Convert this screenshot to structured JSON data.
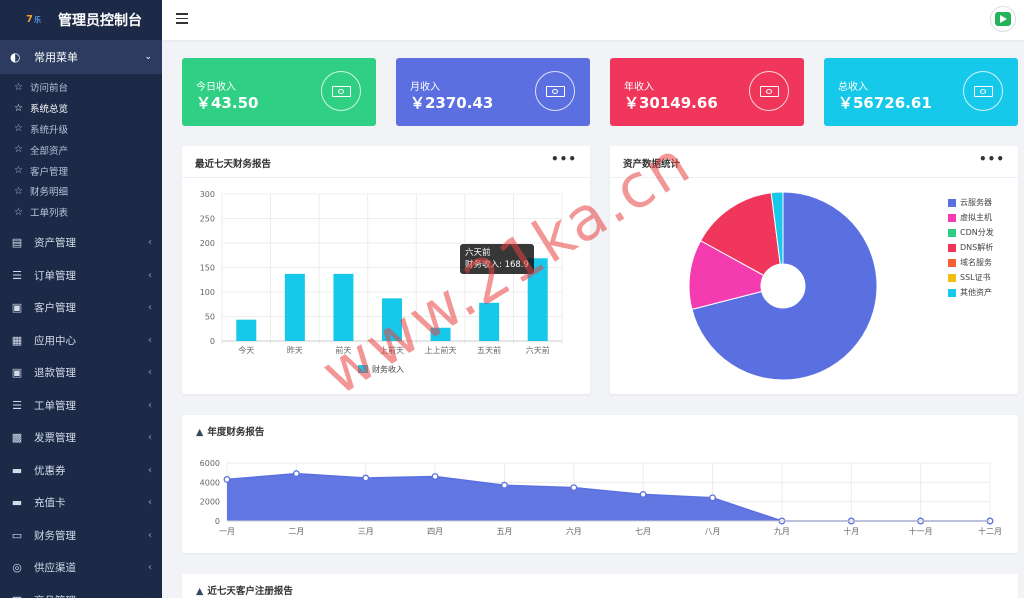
{
  "app": {
    "title": "管理员控制台",
    "logo_left": "7",
    "logo_right": ""
  },
  "sidebar": {
    "section": {
      "label": "常用菜单"
    },
    "sub_items": [
      {
        "label": "访问前台",
        "active": false
      },
      {
        "label": "系统总览",
        "active": true
      },
      {
        "label": "系统升级",
        "active": false
      },
      {
        "label": "全部资产",
        "active": false
      },
      {
        "label": "客户管理",
        "active": false
      },
      {
        "label": "财务明细",
        "active": false
      },
      {
        "label": "工单列表",
        "active": false
      }
    ],
    "items": [
      {
        "label": "资产管理",
        "icon": "server-icon"
      },
      {
        "label": "订单管理",
        "icon": "list-icon"
      },
      {
        "label": "客户管理",
        "icon": "id-card-icon"
      },
      {
        "label": "应用中心",
        "icon": "windows-icon"
      },
      {
        "label": "退款管理",
        "icon": "money-icon"
      },
      {
        "label": "工单管理",
        "icon": "menu-icon"
      },
      {
        "label": "发票管理",
        "icon": "sticky-note-icon"
      },
      {
        "label": "优惠券",
        "icon": "ticket-icon"
      },
      {
        "label": "充值卡",
        "icon": "credit-card-icon"
      },
      {
        "label": "财务管理",
        "icon": "wallet-icon"
      },
      {
        "label": "供应渠道",
        "icon": "lifebuoy-icon"
      },
      {
        "label": "商品管理",
        "icon": "shopping-bag-icon"
      }
    ]
  },
  "stats": [
    {
      "label": "今日收入",
      "value": "￥43.50",
      "color": "#2fcf84"
    },
    {
      "label": "月收入",
      "value": "￥2370.43",
      "color": "#5c6fe0"
    },
    {
      "label": "年收入",
      "value": "￥30149.66",
      "color": "#f0365b"
    },
    {
      "label": "总收入",
      "value": "￥56726.61",
      "color": "#16c9ea"
    }
  ],
  "weekly_panel": {
    "title": "最近七天财务报告",
    "more": "•••"
  },
  "assets_panel": {
    "title": "资产数据统计",
    "more": "•••"
  },
  "yearly_panel": {
    "title": "年度财务报告"
  },
  "customer_panel": {
    "title": "近七天客户注册报告"
  },
  "tooltip": {
    "title": "六天前",
    "line": "财务收入: 168.9"
  },
  "watermark": "www.21ka.cn",
  "chart_data": [
    {
      "type": "bar",
      "categories": [
        "今天",
        "昨天",
        "前天",
        "上前天",
        "上上前天",
        "五天前",
        "六天前"
      ],
      "series": [
        {
          "name": "财务收入",
          "values": [
            43.5,
            137,
            137,
            87,
            27,
            78,
            168.9
          ]
        }
      ],
      "ylim": [
        0,
        300
      ],
      "yticks": [
        0,
        50,
        100,
        150,
        200,
        250,
        300
      ],
      "color": "#16c9ea",
      "legend": "bottom"
    },
    {
      "type": "pie",
      "labels": [
        "云服务器",
        "虚拟主机",
        "CDN分发",
        "DNS解析",
        "域名服务",
        "SSL证书",
        "其他资产"
      ],
      "values": [
        71,
        12,
        0,
        15,
        0,
        0,
        2
      ],
      "colors": [
        "#5b70e0",
        "#f53bb0",
        "#2ecc84",
        "#f0365b",
        "#f35e35",
        "#f2bf15",
        "#16c9ea"
      ],
      "legend": "right"
    },
    {
      "type": "area",
      "categories": [
        "一月",
        "二月",
        "三月",
        "四月",
        "五月",
        "六月",
        "七月",
        "八月",
        "九月",
        "十月",
        "十一月",
        "十二月"
      ],
      "values": [
        4300,
        4900,
        4450,
        4600,
        3700,
        3450,
        2750,
        2400,
        0,
        0,
        0,
        0
      ],
      "ylim": [
        0,
        6000
      ],
      "yticks": [
        0,
        2000,
        4000,
        6000
      ],
      "color": "#5b70e0"
    }
  ]
}
